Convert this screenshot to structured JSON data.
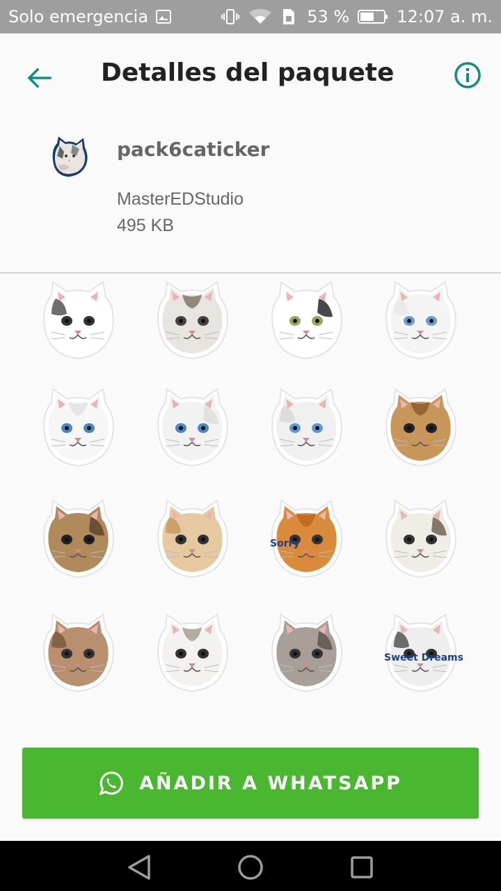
{
  "status_bar": {
    "carrier": "Solo emergencia",
    "battery_percent": "53 %",
    "time": "12:07 a. m.",
    "icons": [
      "image-icon",
      "vibrate-icon",
      "wifi-icon",
      "sim-icon",
      "battery-icon"
    ]
  },
  "app_bar": {
    "title": "Detalles del paquete",
    "back_icon": "arrow-back-icon",
    "info_icon": "info-icon",
    "accent_color": "#128c7e"
  },
  "pack": {
    "name": "pack6caticker",
    "publisher": "MasterEDStudio",
    "size": "495 KB"
  },
  "stickers": [
    {
      "name": "cat-white-gray-paws",
      "fur": "#ffffff",
      "patch": "#555555",
      "eyes": "#333333"
    },
    {
      "name": "cat-tabby-lying",
      "fur": "#e8e4e0",
      "patch": "#7a6e62",
      "eyes": "#444444"
    },
    {
      "name": "cat-black-white-face",
      "fur": "#ffffff",
      "patch": "#1a1a1a",
      "eyes": "#9aa55a"
    },
    {
      "name": "cat-white-surprised",
      "fur": "#f4f4f4",
      "patch": "#e8e8e8",
      "eyes": "#6b9ecf"
    },
    {
      "name": "cat-white-blue-eyes",
      "fur": "#f6f6f6",
      "patch": "#e2e2e2",
      "eyes": "#4b86c4"
    },
    {
      "name": "cat-white-tilted",
      "fur": "#f2f2f2",
      "patch": "#dcdcdc",
      "eyes": "#4b86c4"
    },
    {
      "name": "cat-white-grumpy",
      "fur": "#f0f0f0",
      "patch": "#d8d8d8",
      "eyes": "#5a9ad0"
    },
    {
      "name": "cat-tabby-squint",
      "fur": "#c9965a",
      "patch": "#8a5a2a",
      "eyes": "#222222"
    },
    {
      "name": "cat-tabby-sleepy",
      "fur": "#b08a5a",
      "patch": "#5a4028",
      "eyes": "#222222"
    },
    {
      "name": "cat-orange-yawn",
      "fur": "#e6c9a0",
      "patch": "#c69a60",
      "eyes": "#333333"
    },
    {
      "name": "cat-ginger-kitten-sorry",
      "fur": "#d98a3a",
      "patch": "#b8661e",
      "eyes": "#333333",
      "caption": "Sorry"
    },
    {
      "name": "cat-calico-sitting",
      "fur": "#f0ece6",
      "patch": "#6a5a4a",
      "eyes": "#333333"
    },
    {
      "name": "cat-tabby-standing",
      "fur": "#b89070",
      "patch": "#7a5a40",
      "eyes": "#333333"
    },
    {
      "name": "cat-white-smiling",
      "fur": "#f4f2f0",
      "patch": "#a09890",
      "eyes": "#333333"
    },
    {
      "name": "cat-dancing",
      "fur": "#a8a098",
      "patch": "#5a524a",
      "eyes": "#333333"
    },
    {
      "name": "cat-sweet-dreams",
      "fur": "#eeeeee",
      "patch": "#555555",
      "eyes": "#333333",
      "caption": "Sweet Dreams"
    }
  ],
  "add_button": {
    "label": "AÑADIR A WHATSAPP",
    "icon": "whatsapp-icon",
    "color": "#4ab731"
  },
  "nav_bar": {
    "icons": [
      "back-triangle-icon",
      "home-circle-icon",
      "recents-square-icon"
    ]
  }
}
